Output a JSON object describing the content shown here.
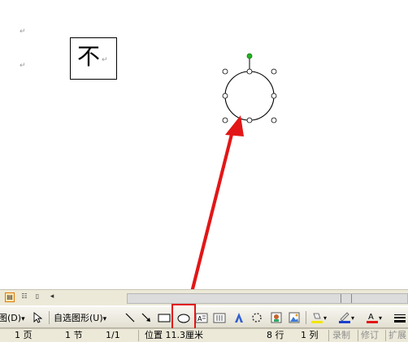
{
  "document": {
    "paragraph_mark": "↵",
    "textbox_char": "不"
  },
  "view_buttons": [
    "normal-view",
    "web-view",
    "reading-view"
  ],
  "draw_toolbar": {
    "draw_menu": "图(D)",
    "dropdown_arrow": "▾",
    "autoshapes_menu": "自选图形(U)"
  },
  "status_bar": {
    "page": "1 页",
    "section": "1 节",
    "page_of": "1/1",
    "position": "位置 11.3厘米",
    "line": "8 行",
    "column": "1 列",
    "record": "录制",
    "revise": "修订",
    "extend": "扩展"
  },
  "colors": {
    "highlight_box": "#e21616",
    "arrow": "#e21616",
    "rotate_handle": "#22b322",
    "fill_color": "#f2e600",
    "line_color": "#1a3fd1",
    "font_color": "#e21616"
  }
}
